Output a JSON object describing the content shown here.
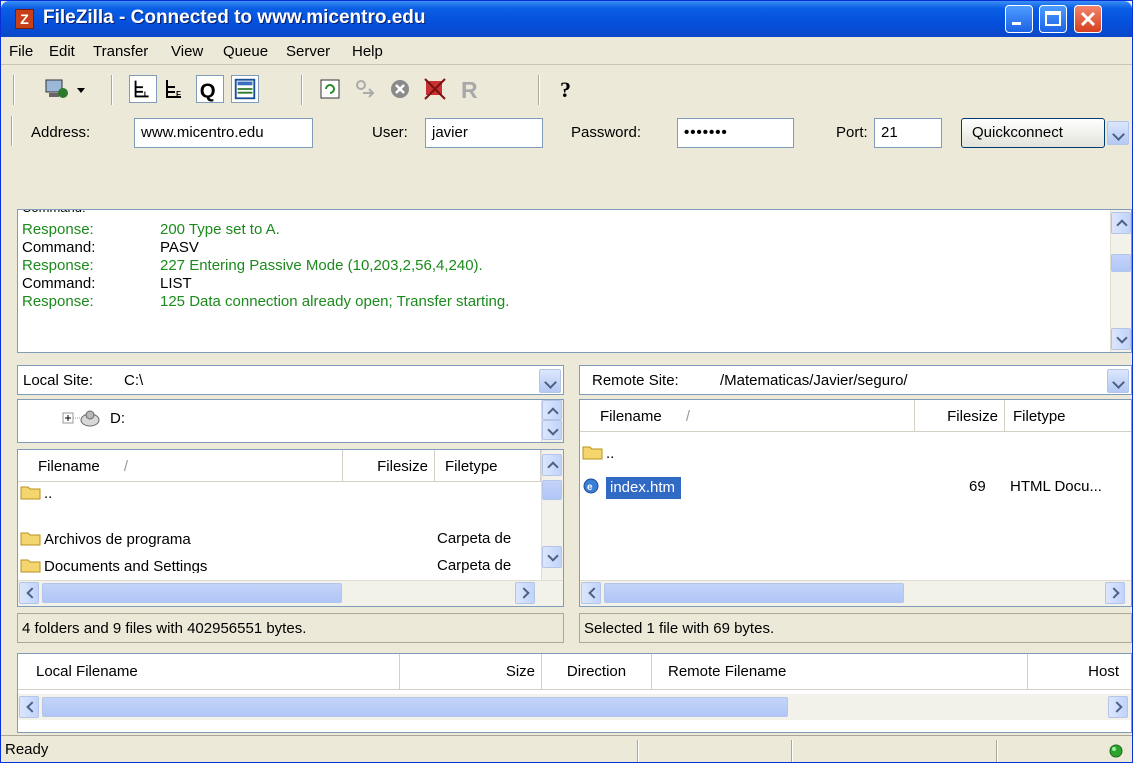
{
  "window": {
    "title": "FileZilla - Connected to www.micentro.edu"
  },
  "menu": [
    "File",
    "Edit",
    "Transfer",
    "View",
    "Queue",
    "Server",
    "Help"
  ],
  "toolbar_icons": [
    "site-manager-icon",
    "dropdown-arrow-icon",
    "toggle-log-icon",
    "toggle-local-tree-icon",
    "toggle-queue-icon",
    "toggle-remote-tree-icon",
    "refresh-icon",
    "process-queue-icon",
    "cancel-icon",
    "disconnect-icon",
    "reconnect-icon",
    "help-icon"
  ],
  "quickconnect": {
    "address_label": "Address:",
    "address_value": "www.micentro.edu",
    "user_label": "User:",
    "user_value": "javier",
    "password_label": "Password:",
    "password_value": "•••••••",
    "port_label": "Port:",
    "port_value": "21",
    "button_label": "Quickconnect"
  },
  "log": [
    {
      "kind": "Response:",
      "text": "200 Type set to A.",
      "type": "response"
    },
    {
      "kind": "Command:",
      "text": "PASV",
      "type": "command"
    },
    {
      "kind": "Response:",
      "text": "227 Entering Passive Mode (10,203,2,56,4,240).",
      "type": "response"
    },
    {
      "kind": "Command:",
      "text": "LIST",
      "type": "command"
    },
    {
      "kind": "Response:",
      "text": "125 Data connection already open; Transfer starting.",
      "type": "response"
    }
  ],
  "local": {
    "site_label": "Local Site:",
    "site_value": "C:\\",
    "tree_item": "D:",
    "columns": [
      "Filename",
      "Filesize",
      "Filetype"
    ],
    "sort_indicator": "/",
    "files": [
      {
        "name": "..",
        "type": ""
      },
      {
        "name": "Archivos de programa",
        "type": "Carpeta de"
      },
      {
        "name": "Documents and Settings",
        "type": "Carpeta de"
      }
    ],
    "status": "4 folders and 9 files with 402956551 bytes."
  },
  "remote": {
    "site_label": "Remote Site:",
    "site_value": "/Matematicas/Javier/seguro/",
    "columns": [
      "Filename",
      "Filesize",
      "Filetype"
    ],
    "sort_indicator": "/",
    "files": [
      {
        "name": "..",
        "size": "",
        "type": ""
      },
      {
        "name": "index.htm",
        "size": "69",
        "type": "HTML Docu..."
      }
    ],
    "status": "Selected 1 file with 69 bytes."
  },
  "queue": {
    "columns": [
      "Local Filename",
      "Size",
      "Direction",
      "Remote Filename",
      "Host"
    ]
  },
  "statusbar": {
    "text": "Ready"
  },
  "colors": {
    "title_blue": "#0550dc",
    "response_green": "#1c8a1c",
    "selection_blue": "#316ac5"
  }
}
